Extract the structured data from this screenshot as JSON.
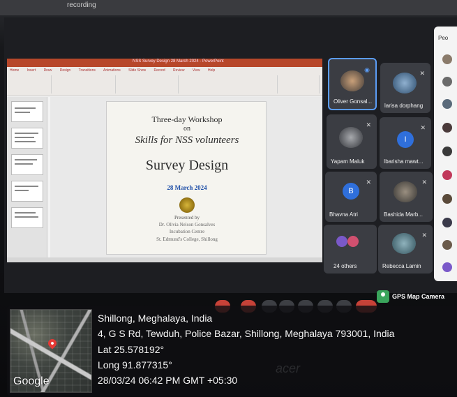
{
  "top_strip": {
    "text": "recording"
  },
  "presentation": {
    "window_title": "NSS Survey Design 28 March 2024 - PowerPoint",
    "ribbon_tabs": [
      "Home",
      "Insert",
      "Draw",
      "Design",
      "Transitions",
      "Animations",
      "Slide Show",
      "Record",
      "Review",
      "View",
      "Help"
    ],
    "slide": {
      "line1": "Three-day Workshop",
      "line2": "on",
      "line3": "Skills for NSS volunteers",
      "title": "Survey Design",
      "date": "28 March 2024",
      "presented_by": "Presented by",
      "presenter": "Dr. Olivia Nelson Gonsalves",
      "role": "Incubation Centre",
      "college": "St. Edmund's College, Shillong"
    }
  },
  "participants": [
    {
      "name": "Oliver Gonsal...",
      "initial": "",
      "color": "#6b5a4c"
    },
    {
      "name": "larisa dorphang",
      "initial": "",
      "color": "#4a6a8a"
    },
    {
      "name": "Yapam Maluk",
      "initial": "",
      "color": "#8a8c90"
    },
    {
      "name": "Ibarisha mawt...",
      "initial": "I",
      "color": "#2f6fdb"
    },
    {
      "name": "Bhavna Atri",
      "initial": "B",
      "color": "#2f6fdb"
    },
    {
      "name": "Bashida Marb...",
      "initial": "",
      "color": "#54504a"
    },
    {
      "name": "24 others",
      "initial": "",
      "color": "#7a59c9"
    },
    {
      "name": "Rebecca Lamin",
      "initial": "",
      "color": "#4d6e78"
    }
  ],
  "people_panel": {
    "title": "Peo"
  },
  "gps": {
    "app_name": "GPS Map Camera",
    "map_label": "Google",
    "city": "Shillong, Meghalaya, India",
    "address": "4, G S Rd, Tewduh, Police Bazar, Shillong, Meghalaya 793001, India",
    "lat": "Lat 25.578192°",
    "long": "Long 91.877315°",
    "datetime": "28/03/24 06:42 PM GMT +05:30"
  },
  "bezel": {
    "logo": "acer"
  }
}
